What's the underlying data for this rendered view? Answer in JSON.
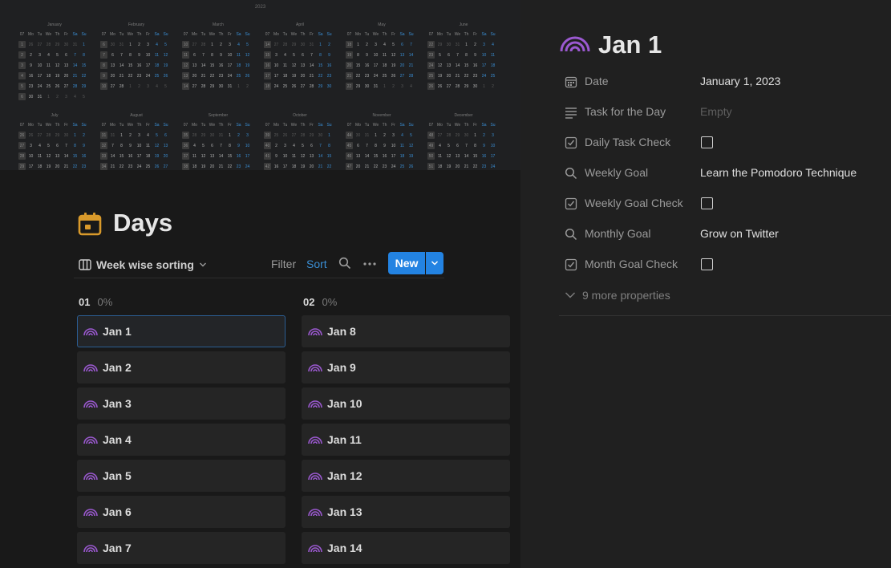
{
  "cover": {
    "year": "2023",
    "weekday_headers": [
      "07",
      "Mo",
      "Tu",
      "We",
      "Th",
      "Fr",
      "Sa",
      "Su"
    ],
    "months": [
      "January",
      "February",
      "March",
      "April",
      "May",
      "June",
      "July",
      "August",
      "September",
      "October",
      "November",
      "December"
    ]
  },
  "database": {
    "title": "Days",
    "icon": "calendar-icon",
    "view_label": "Week wise sorting",
    "filter_label": "Filter",
    "sort_label": "Sort",
    "new_label": "New",
    "accent": "#2383e2",
    "groups": [
      {
        "name": "01",
        "percent": "0%",
        "cards": [
          "Jan 1",
          "Jan 2",
          "Jan 3",
          "Jan 4",
          "Jan 5",
          "Jan 6",
          "Jan 7"
        ]
      },
      {
        "name": "02",
        "percent": "0%",
        "cards": [
          "Jan 8",
          "Jan 9",
          "Jan 10",
          "Jan 11",
          "Jan 12",
          "Jan 13",
          "Jan 14"
        ]
      }
    ]
  },
  "peek": {
    "title": "Jan 1",
    "icon": "rainbow-icon",
    "icon_color": "#9b59d0",
    "properties": [
      {
        "label": "Date",
        "icon": "calendar-grid-icon",
        "value": "January 1, 2023",
        "kind": "text"
      },
      {
        "label": "Task for the Day",
        "icon": "text-lines-icon",
        "value": "Empty",
        "kind": "empty"
      },
      {
        "label": "Daily Task Check",
        "icon": "checkbox-icon",
        "value": "",
        "kind": "check"
      },
      {
        "label": "Weekly Goal",
        "icon": "search-icon",
        "value": "Learn the Pomodoro Technique",
        "kind": "text"
      },
      {
        "label": "Weekly Goal Check",
        "icon": "checkbox-icon",
        "value": "",
        "kind": "check"
      },
      {
        "label": "Monthly Goal",
        "icon": "search-icon",
        "value": "Grow on Twitter",
        "kind": "text"
      },
      {
        "label": "Month Goal Check",
        "icon": "checkbox-icon",
        "value": "",
        "kind": "check"
      }
    ],
    "more_properties": "9 more properties"
  }
}
